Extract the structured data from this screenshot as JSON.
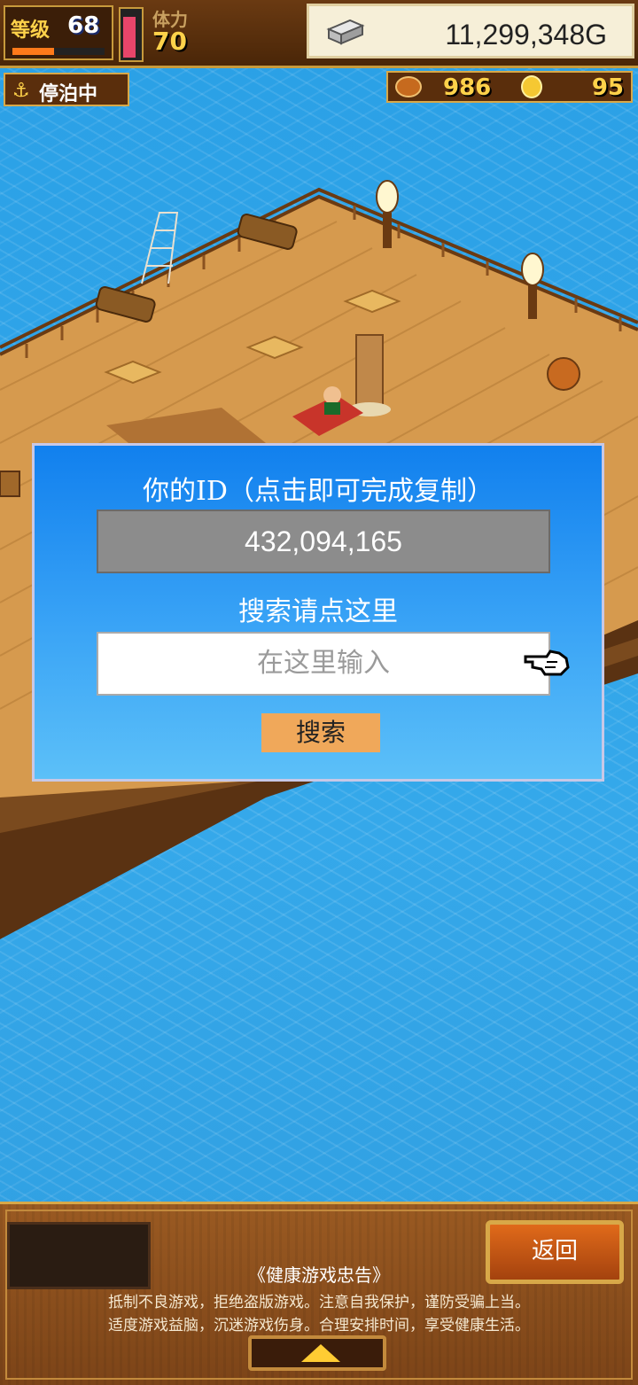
{
  "hud": {
    "level_label": "等级",
    "level": "68",
    "level_progress": 0.45,
    "stamina_label": "体力",
    "stamina": "70",
    "stamina_fill": 0.92,
    "gold": "11,299,348G",
    "status": "停泊中",
    "food_count": "986",
    "medal_count": "95"
  },
  "dialog": {
    "title": "你的ID（点击即可完成复制）",
    "user_id": "432,094,165",
    "search_hint": "搜索请点这里",
    "search_placeholder": "在这里输入",
    "search_button": "搜索"
  },
  "bottom": {
    "back_button": "返回",
    "notice_title": "《健康游戏忠告》",
    "notice_line1": "抵制不良游戏，拒绝盗版游戏。注意自我保护，谨防受骗上当。",
    "notice_line2": "适度游戏益脑，沉迷游戏伤身。合理安排时间，享受健康生活。"
  },
  "icons": {
    "gold": "silver-ingot-icon",
    "status": "anchor-icon",
    "food": "food-icon",
    "medal": "medal-icon",
    "pointer": "pointing-hand-icon",
    "expand": "up-arrow-icon"
  }
}
